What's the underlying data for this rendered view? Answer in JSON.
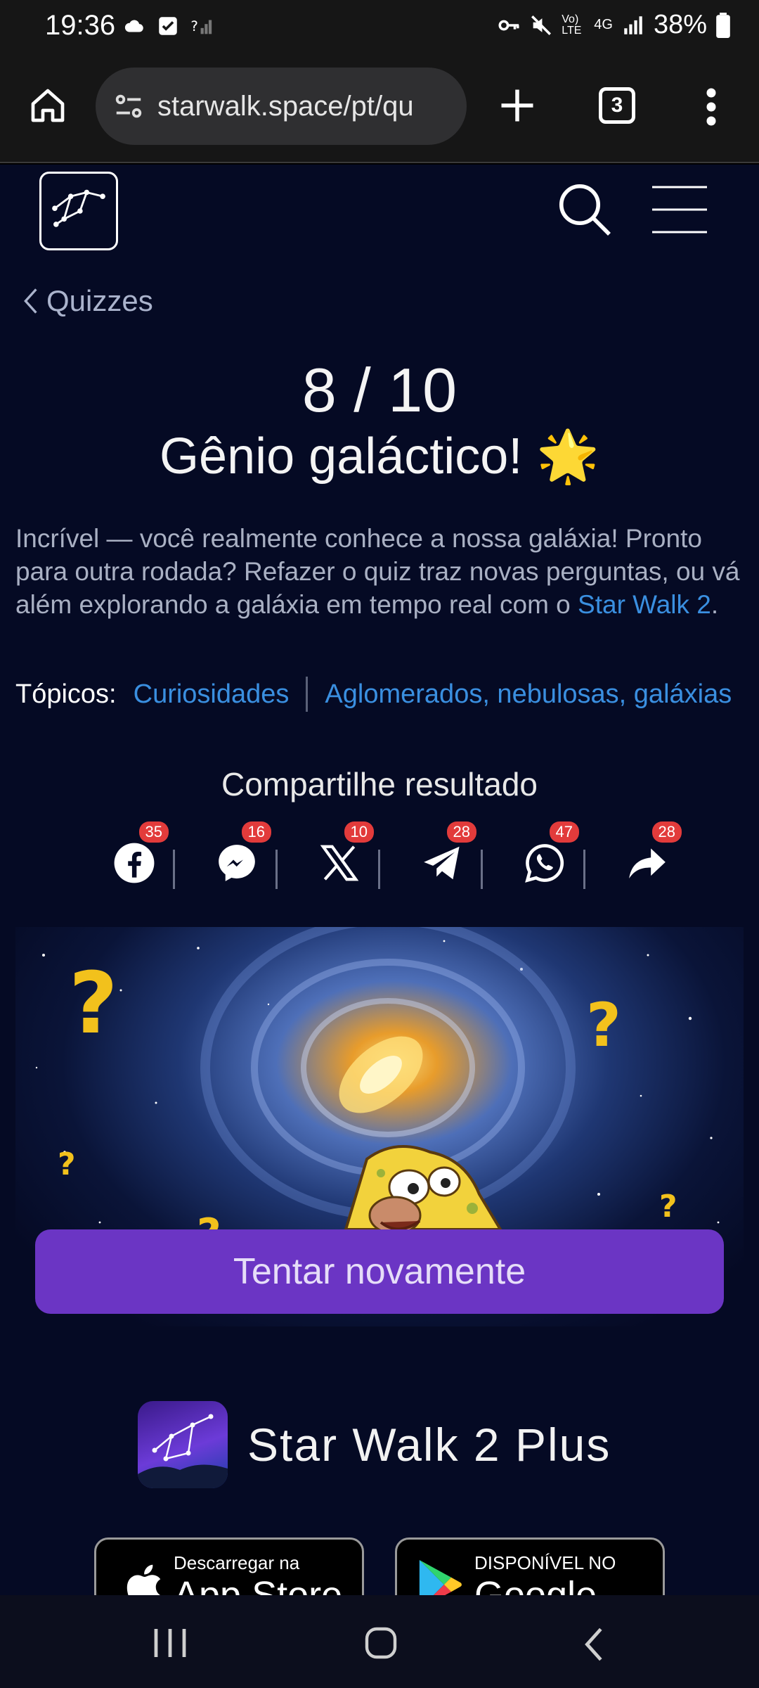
{
  "status_bar": {
    "time": "19:36",
    "battery": "38%",
    "network": "4G",
    "volte": "Vo) LTE"
  },
  "browser": {
    "url": "starwalk.space/pt/qu",
    "tab_count": "3",
    "icons": [
      "home-icon",
      "site-settings-icon",
      "plus-icon",
      "tabs-icon",
      "more-vert-icon"
    ]
  },
  "page": {
    "back_label": "Quizzes",
    "score": "8 / 10",
    "result_title": "Gênio galáctico! 🌟",
    "description_prefix": "Incrível — você realmente conhece a nossa galáxia! Pronto para outra rodada? Refazer o quiz traz novas perguntas, ou vá além explorando a galáxia em tempo real com o ",
    "description_link": "Star Walk 2",
    "description_suffix": ".",
    "topics_label": "Tópicos:",
    "topics": [
      "Curiosidades",
      "Aglomerados, nebulosas, galáxias"
    ],
    "share_title": "Compartilhe resultado",
    "share": [
      {
        "icon": "facebook-icon",
        "count": "35"
      },
      {
        "icon": "messenger-icon",
        "count": "16"
      },
      {
        "icon": "x-icon",
        "count": "10"
      },
      {
        "icon": "telegram-icon",
        "count": "28"
      },
      {
        "icon": "whatsapp-icon",
        "count": "47"
      },
      {
        "icon": "share-icon",
        "count": "28"
      }
    ],
    "retry_button": "Tentar novamente",
    "app_name": "Star Walk 2 Plus",
    "app_store": {
      "small": "Descarregar na",
      "big": "App Store"
    },
    "google_play": {
      "small": "DISPONÍVEL NO",
      "big": "Google Play"
    }
  },
  "colors": {
    "page_bg": "#050a24",
    "link": "#3a8fe0",
    "button": "#6b35c4",
    "badge": "#e23b3b"
  }
}
